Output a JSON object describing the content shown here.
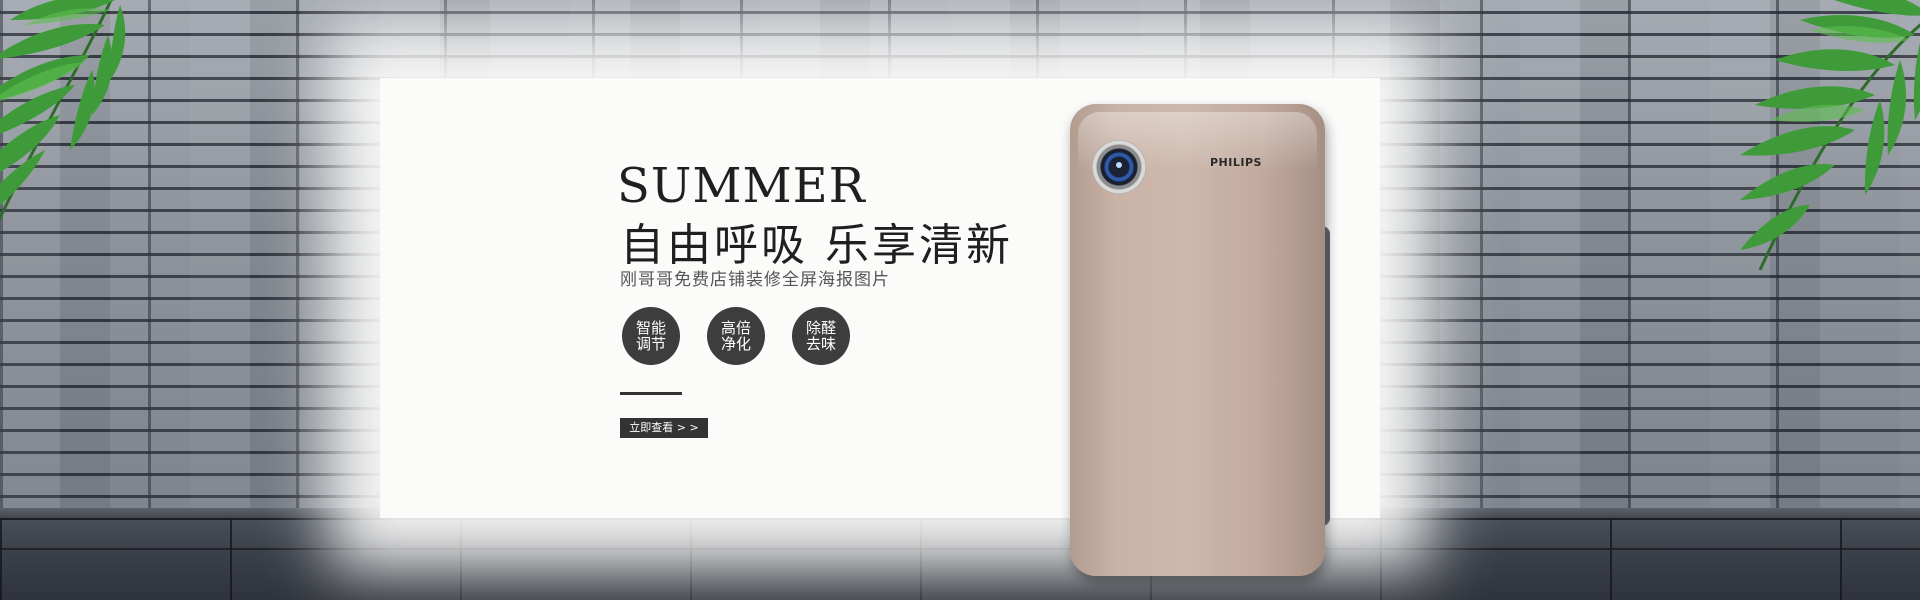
{
  "banner": {
    "headline_en": "SUMMER",
    "headline_cn": "自由呼吸 乐享清新",
    "subtitle": "刚哥哥免费店铺装修全屏海报图片",
    "features": [
      {
        "label": "智能调节"
      },
      {
        "label": "高倍净化"
      },
      {
        "label": "除醛去味"
      }
    ],
    "cta_label": "立即查看 > >"
  },
  "product": {
    "brand": "PHILIPS",
    "icon": "air-purifier-icon"
  },
  "colors": {
    "background_wall": "#8e949c",
    "panel": "#fbfbfa",
    "feature_circle": "#3d3d3d",
    "cta": "#333333",
    "product": "#c9b3a6",
    "leaves": "#3f9b3a"
  }
}
